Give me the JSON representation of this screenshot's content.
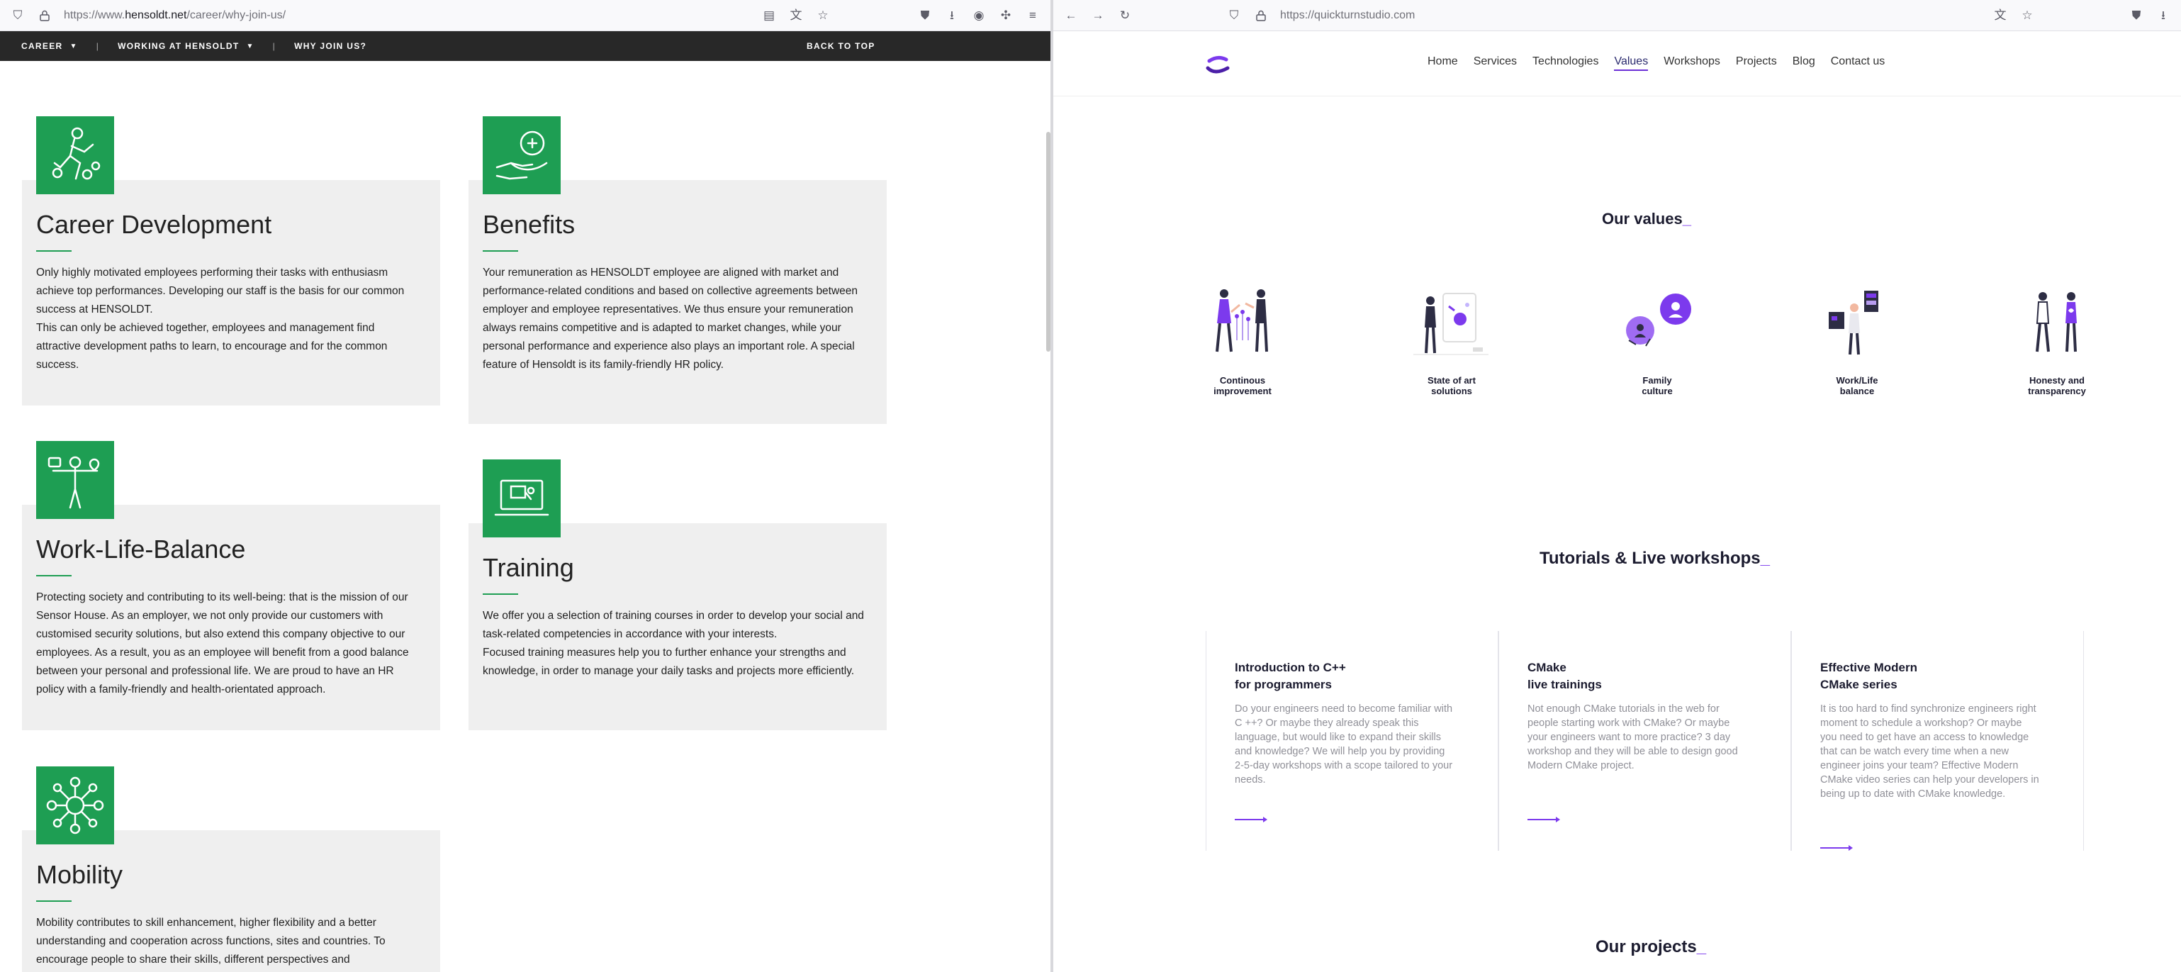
{
  "left_browser": {
    "url_prefix": "https://www.",
    "url_domain": "hensoldt.net",
    "url_path": "/career/why-join-us/",
    "nav": {
      "career": "CAREER",
      "working": "WORKING AT HENSOLDT",
      "why": "WHY JOIN US?",
      "back_to_top": "BACK TO TOP"
    },
    "cards": [
      {
        "title": "Career Development",
        "text": "Only highly motivated employees performing their tasks with enthusiasm achieve top performances. Developing our staff is the basis for our common success at HENSOLDT.\nThis can only be achieved together, employees and management find attractive development paths to learn, to encourage and for the common success."
      },
      {
        "title": "Benefits",
        "text": "Your remuneration as HENSOLDT employee are aligned with market and performance-related conditions and based on collective agreements between employer and employee representatives. We thus ensure your remuneration always remains competitive and is adapted to market changes, while your personal performance and experience also plays an important role. A special feature of Hensoldt is its family-friendly HR policy."
      },
      {
        "title": "Work-Life-Balance",
        "text": "Protecting society and contributing to its well-being: that is the mission of our Sensor House. As an employer, we not only provide our customers with customised security solutions, but also extend this company objective to our employees. As a result, you as an employee will benefit from a good balance between your personal and professional life. We are proud to have an HR policy with a family-friendly and health-orientated approach."
      },
      {
        "title": "Training",
        "text": "We offer you a selection of training courses in order to develop your social and task-related competencies in accordance with your  interests.\nFocused training measures help you to further enhance your strengths and knowledge, in order to manage your daily tasks and projects more efficiently."
      },
      {
        "title": "Mobility",
        "text": "Mobility contributes to skill enhancement, higher flexibility and a better understanding and cooperation across functions, sites and countries. To encourage people to share their skills, different perspectives and"
      }
    ]
  },
  "right_browser": {
    "url": "https://quickturnstudio.com",
    "menu": [
      "Home",
      "Services",
      "Technologies",
      "Values",
      "Workshops",
      "Projects",
      "Blog",
      "Contact us"
    ],
    "active_menu": "Values",
    "values_heading": "Our values",
    "values": [
      {
        "line1": "Continous",
        "line2": "improvement"
      },
      {
        "line1": "State of art",
        "line2": "solutions"
      },
      {
        "line1": "Family",
        "line2": "culture"
      },
      {
        "line1": "Work/Life",
        "line2": "balance"
      },
      {
        "line1": "Honesty and",
        "line2": "transparency"
      }
    ],
    "workshops_heading": "Tutorials & Live workshops",
    "workshops": [
      {
        "title_line1": "Introduction to C++",
        "title_line2": "for programmers",
        "text": "Do your engineers need to become familiar with C ++? Or maybe they already speak this language, but would like to expand their skills and knowledge? We will help you by providing 2-5-day workshops with a scope tailored to your needs."
      },
      {
        "title_line1": "CMake",
        "title_line2": "live trainings",
        "text": "Not enough CMake tutorials in the web for people starting work with CMake? Or maybe your engineers want to more practice? 3 day workshop and they will be able to design good Modern CMake project."
      },
      {
        "title_line1": "Effective Modern",
        "title_line2": "CMake series",
        "text": "It is too hard to find synchronize engineers right moment to schedule a workshop? Or maybe you need to get have an access to knowledge that can be watch every time when a new engineer joins your team? Effective Modern CMake video series can help your developers in being up to date with CMake knowledge."
      }
    ],
    "projects_heading": "Our projects",
    "underscore": "_"
  },
  "colors": {
    "hensoldt_green": "#1e9e53",
    "hensoldt_nav": "#282828",
    "qs_accent": "#7c3aed",
    "panel_gray": "#efefef"
  }
}
